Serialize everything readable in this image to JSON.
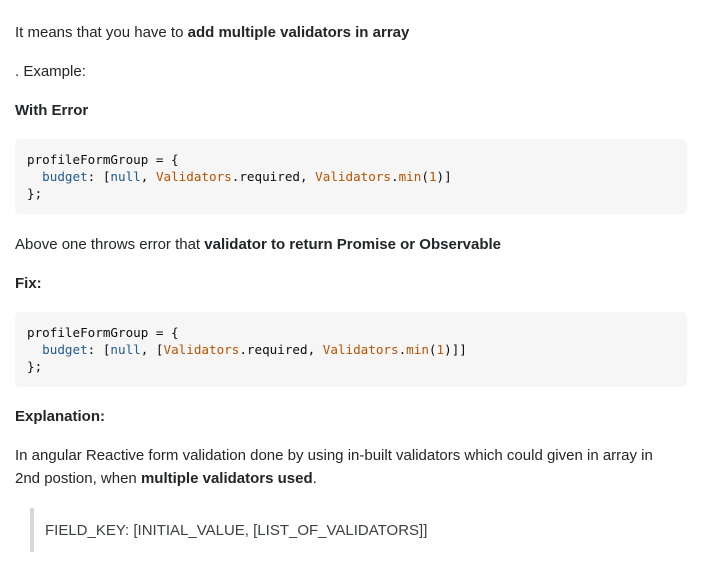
{
  "intro": {
    "text": "It means that you have to ",
    "bold": "add multiple validators in array"
  },
  "example_label": ". Example:",
  "with_error_heading": "With Error",
  "code_error": {
    "line1": "profileFormGroup = {",
    "line2_indent": "  ",
    "line2_prop": "budget",
    "line2_colon": ": [",
    "line2_null": "null",
    "line2_comma1": ", ",
    "line2_cls1": "Validators",
    "line2_member1": ".required, ",
    "line2_cls2": "Validators",
    "line2_dot": ".",
    "line2_fn": "min",
    "line2_open": "(",
    "line2_num": "1",
    "line2_close": ")]",
    "line3": "};"
  },
  "error_note": {
    "text": "Above one throws error that ",
    "bold": "validator to return Promise or Observable"
  },
  "fix_heading": "Fix:",
  "code_fix": {
    "line1": "profileFormGroup = {",
    "line2_indent": "  ",
    "line2_prop": "budget",
    "line2_colon": ": [",
    "line2_null": "null",
    "line2_comma1": ", [",
    "line2_cls1": "Validators",
    "line2_member1": ".required, ",
    "line2_cls2": "Validators",
    "line2_dot": ".",
    "line2_fn": "min",
    "line2_open": "(",
    "line2_num": "1",
    "line2_close": ")]]",
    "line3": "};"
  },
  "explanation_heading": "Explanation:",
  "explanation": {
    "line1": "In angular Reactive form validation done by using in-built validators which could given in array in",
    "line2_text": "2nd postion, when ",
    "line2_bold": "multiple validators used",
    "line2_end": "."
  },
  "blockquote": "FIELD_KEY: [INITIAL_VALUE, [LIST_OF_VALIDATORS]]"
}
